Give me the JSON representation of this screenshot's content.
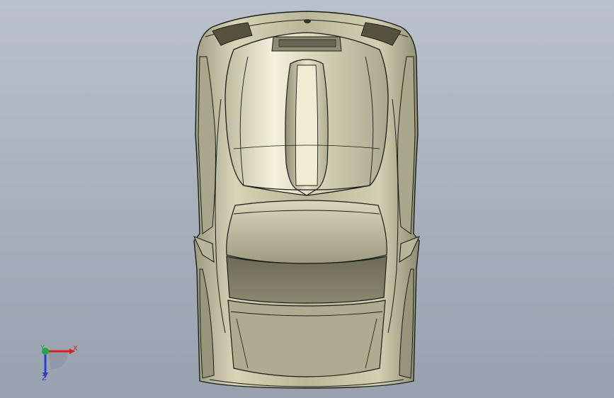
{
  "viewport": {
    "background_top": "#b9c2cc",
    "background_bottom": "#98a2ae"
  },
  "model": {
    "body_color": "#c9c6a8",
    "edge_color": "#1c1c18"
  },
  "triad": {
    "x_label": "X",
    "y_label": "Y",
    "z_label": "Z",
    "x_color": "#d42020",
    "y_color": "#27a34a",
    "z_color": "#2d3fc2"
  }
}
